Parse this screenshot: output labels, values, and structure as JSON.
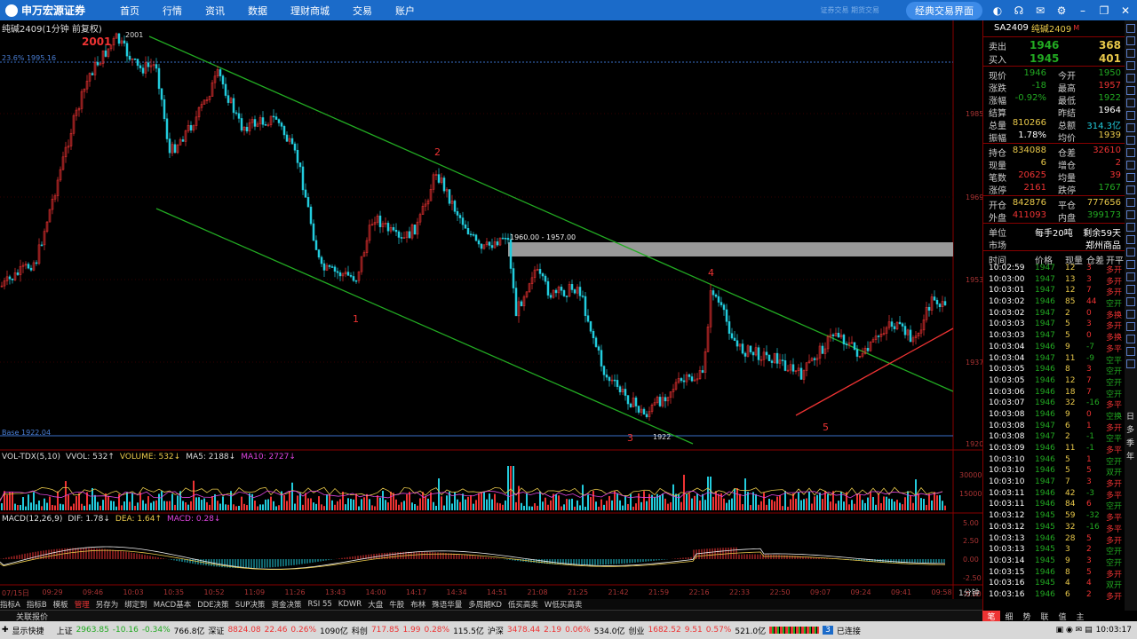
{
  "topbar": {
    "logo": "申万宏源证券",
    "menus": [
      "首页",
      "行情",
      "资讯",
      "数据",
      "理财商城",
      "交易",
      "账户"
    ],
    "faint": "证券交易 期货交易",
    "classic_btn": "经典交易界面",
    "icons": [
      "skin-icon",
      "headset-icon",
      "mail-icon",
      "settings-icon",
      "minimize-icon",
      "restore-icon",
      "close-icon"
    ]
  },
  "chart": {
    "title": "纯碱2409(1分钟 前复权)",
    "fib_label": "23.6% 1995.16",
    "base_label": "Base 1922.04",
    "peak_value": "2001",
    "peak_annot": "2001",
    "low_value": "1922",
    "range_label": "1960.00 - 1957.00",
    "wave_labels": [
      "1",
      "2",
      "3",
      "4",
      "5"
    ],
    "price_axis": [
      "1985",
      "1969",
      "1953",
      "1937",
      "1920"
    ],
    "vol_axis": [
      "30000",
      "15000"
    ],
    "macd_axis": [
      "5.00",
      "2.50",
      "0.00",
      "-2.50",
      "-5.00"
    ],
    "vol_legend": [
      {
        "text": "VOL-TDX(5,10)",
        "color": "#ddd"
      },
      {
        "text": "VVOL: 532↑",
        "color": "#ddd"
      },
      {
        "text": "VOLUME: 532↓",
        "color": "#e8c84a"
      },
      {
        "text": "MA5: 2188↓",
        "color": "#ddd"
      },
      {
        "text": "MA10: 2727↓",
        "color": "#d4d"
      }
    ],
    "macd_legend": [
      {
        "text": "MACD(12,26,9)",
        "color": "#ddd"
      },
      {
        "text": "DIF: 1.78↓",
        "color": "#ddd"
      },
      {
        "text": "DEA: 1.64↑",
        "color": "#e8c84a"
      },
      {
        "text": "MACD: 0.28↓",
        "color": "#d4d"
      }
    ],
    "time_labels": [
      "07/15日",
      "09:29",
      "09:46",
      "10:03",
      "10:35",
      "10:52",
      "11:09",
      "11:26",
      "13:43",
      "14:00",
      "14:17",
      "14:34",
      "14:51",
      "21:08",
      "21:25",
      "21:42",
      "21:59",
      "22:16",
      "22:33",
      "22:50",
      "09:07",
      "09:24",
      "09:41",
      "09:58"
    ],
    "period": "1分钟"
  },
  "tabs": [
    "指标A",
    "指标B",
    "模板",
    "管理",
    "另存为",
    "绑定到",
    "MACD基本",
    "DDE决策",
    "SUP决策",
    "资金决策",
    "RSI 55",
    "KDWR",
    "大盘",
    "牛股",
    "布林",
    "殊语华量",
    "多周期KD",
    "低买高卖",
    "W低买高卖"
  ],
  "active_tab": "管理",
  "related": "关联报价",
  "quote": {
    "code": "SA2409",
    "name": "纯碱2409",
    "mark": "M",
    "ask": {
      "label": "卖出",
      "price": "1946",
      "vol": "368"
    },
    "bid": {
      "label": "买入",
      "price": "1945",
      "vol": "401"
    },
    "rows1": [
      [
        "现价",
        "1946",
        "今开",
        "1950"
      ],
      [
        "涨跌",
        "-18",
        "最高",
        "1957"
      ],
      [
        "涨幅",
        "-0.92%",
        "最低",
        "1922"
      ],
      [
        "结算",
        "",
        "昨结",
        "1964"
      ],
      [
        "总量",
        "810266",
        "总额",
        "314.3亿"
      ],
      [
        "振幅",
        "1.78%",
        "均价",
        "1939"
      ]
    ],
    "rows2": [
      [
        "持仓",
        "834088",
        "仓差",
        "32610"
      ],
      [
        "现量",
        "6",
        "增仓",
        "2"
      ],
      [
        "笔数",
        "20625",
        "均量",
        "39"
      ],
      [
        "涨停",
        "2161",
        "跌停",
        "1767"
      ]
    ],
    "rows3": [
      [
        "开仓",
        "842876",
        "平仓",
        "777656"
      ],
      [
        "外盘",
        "411093",
        "内盘",
        "399173"
      ]
    ],
    "unit": {
      "label": "单位",
      "value": "每手20吨",
      "extra": "剩余59天"
    },
    "market": {
      "label": "市场",
      "value": "郑州商品"
    },
    "trade_headers": [
      "时间",
      "价格",
      "现量",
      "仓差",
      "开平"
    ],
    "trades": [
      [
        "10:02:59",
        "1947",
        "12",
        "3",
        "多开"
      ],
      [
        "10:03:00",
        "1947",
        "13",
        "3",
        "多开"
      ],
      [
        "10:03:01",
        "1947",
        "12",
        "7",
        "多开"
      ],
      [
        "10:03:02",
        "1946",
        "85",
        "44",
        "空开"
      ],
      [
        "10:03:02",
        "1947",
        "2",
        "0",
        "多换"
      ],
      [
        "10:03:03",
        "1947",
        "5",
        "3",
        "多开"
      ],
      [
        "10:03:03",
        "1947",
        "5",
        "0",
        "多换"
      ],
      [
        "10:03:04",
        "1946",
        "9",
        "-7",
        "多平"
      ],
      [
        "10:03:04",
        "1947",
        "11",
        "-9",
        "空平"
      ],
      [
        "10:03:05",
        "1946",
        "8",
        "3",
        "空开"
      ],
      [
        "10:03:05",
        "1946",
        "12",
        "7",
        "空开"
      ],
      [
        "10:03:06",
        "1946",
        "18",
        "7",
        "空开"
      ],
      [
        "10:03:07",
        "1946",
        "32",
        "-16",
        "多平"
      ],
      [
        "10:03:08",
        "1946",
        "9",
        "0",
        "空换"
      ],
      [
        "10:03:08",
        "1947",
        "6",
        "1",
        "多开"
      ],
      [
        "10:03:08",
        "1947",
        "2",
        "-1",
        "空平"
      ],
      [
        "10:03:09",
        "1946",
        "11",
        "-1",
        "多平"
      ],
      [
        "10:03:10",
        "1946",
        "5",
        "1",
        "空开"
      ],
      [
        "10:03:10",
        "1946",
        "5",
        "5",
        "双开"
      ],
      [
        "10:03:10",
        "1947",
        "7",
        "3",
        "多开"
      ],
      [
        "10:03:11",
        "1946",
        "42",
        "-3",
        "多平"
      ],
      [
        "10:03:11",
        "1946",
        "84",
        "6",
        "空开"
      ],
      [
        "10:03:12",
        "1945",
        "59",
        "-32",
        "多平"
      ],
      [
        "10:03:12",
        "1945",
        "32",
        "-16",
        "多平"
      ],
      [
        "10:03:13",
        "1946",
        "28",
        "5",
        "多开"
      ],
      [
        "10:03:13",
        "1945",
        "3",
        "2",
        "空开"
      ],
      [
        "10:03:14",
        "1945",
        "9",
        "3",
        "空开"
      ],
      [
        "10:03:15",
        "1946",
        "8",
        "5",
        "多开"
      ],
      [
        "10:03:16",
        "1945",
        "4",
        "4",
        "双开"
      ],
      [
        "10:03:16",
        "1946",
        "6",
        "2",
        "多开"
      ]
    ],
    "tabs": [
      "笔",
      "细",
      "势",
      "联",
      "值",
      "主"
    ]
  },
  "side_text": [
    "日",
    "多",
    "季",
    "年"
  ],
  "status": {
    "quick": "显示快捷",
    "sh": {
      "name": "上证",
      "price": "2963.85",
      "chg": "-10.16",
      "pct": "-0.34%",
      "amt": "766.8亿"
    },
    "sz": {
      "name": "深证",
      "price": "8824.08",
      "chg": "22.46",
      "pct": "0.26%",
      "amt": "1090亿"
    },
    "kc": {
      "name": "科创",
      "price": "717.85",
      "chg": "1.99",
      "pct": "0.28%",
      "amt": "115.5亿"
    },
    "hs": {
      "name": "沪深",
      "price": "3478.44",
      "chg": "2.19",
      "pct": "0.06%",
      "amt": "534.0亿"
    },
    "cy": {
      "name": "创业",
      "price": "1682.52",
      "chg": "9.51",
      "pct": "0.57%",
      "amt": "521.0亿"
    },
    "conn": "已连接",
    "time": "10:03:17"
  },
  "colors": {
    "up": "#e33",
    "down": "#2a2",
    "channel": "#2a2",
    "support": "#e33",
    "accent": "#1b6bc9"
  }
}
